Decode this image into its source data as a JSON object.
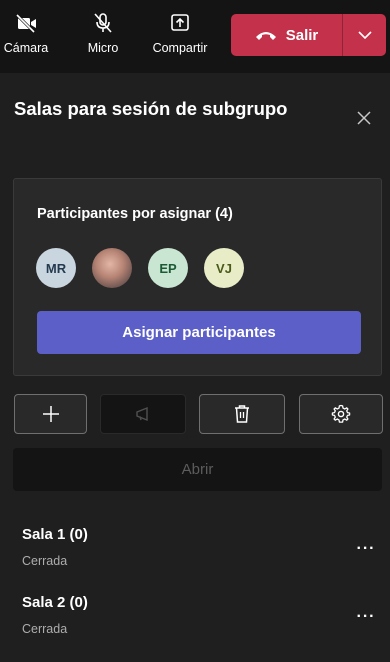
{
  "toolbar": {
    "camera_label": "Cámara",
    "mic_label": "Micro",
    "share_label": "Compartir",
    "leave_label": "Salir",
    "leave_color": "#c4314b"
  },
  "panel": {
    "title": "Salas para sesión de subgrupo"
  },
  "unassigned": {
    "title": "Participantes por asignar (4)",
    "avatars": [
      {
        "initials": "MR"
      },
      {
        "initials": ""
      },
      {
        "initials": "EP"
      },
      {
        "initials": "VJ"
      }
    ],
    "assign_label": "Asignar participantes",
    "accent": "#5b5fc7"
  },
  "actions": {
    "icons": [
      "plus-icon",
      "megaphone-icon",
      "trash-icon",
      "gear-icon"
    ],
    "open_label": "Abrir"
  },
  "rooms": [
    {
      "name": "Sala 1  (0)",
      "status": "Cerrada"
    },
    {
      "name": "Sala 2  (0)",
      "status": "Cerrada"
    }
  ]
}
